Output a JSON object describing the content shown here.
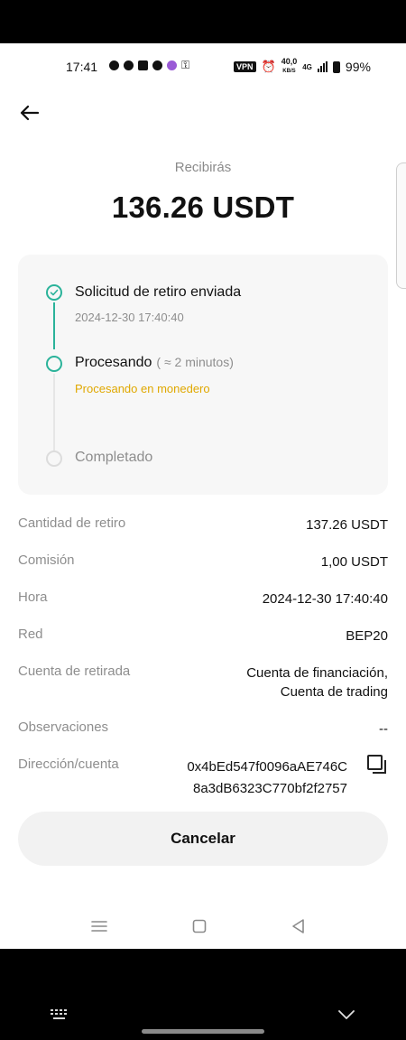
{
  "status_bar": {
    "time": "17:41",
    "vpn": "VPN",
    "speed_value": "40,0",
    "speed_unit": "KB/S",
    "network": "4G",
    "battery": "99%"
  },
  "header": {
    "receive_label": "Recibirás",
    "amount": "136.26 USDT"
  },
  "timeline": {
    "steps": [
      {
        "title": "Solicitud de retiro enviada",
        "subtitle": "2024-12-30 17:40:40",
        "state": "done"
      },
      {
        "title": "Procesando",
        "eta": "( ≈ 2 minutos)",
        "subtitle": "Procesando en monedero",
        "state": "active"
      },
      {
        "title": "Completado",
        "state": "pending"
      }
    ],
    "active_color": "#2bb39a",
    "warning_color": "#e0a800"
  },
  "details": [
    {
      "label": "Cantidad de retiro",
      "value": "137.26 USDT"
    },
    {
      "label": "Comisión",
      "value": "1,00 USDT"
    },
    {
      "label": "Hora",
      "value": "2024-12-30 17:40:40"
    },
    {
      "label": "Red",
      "value": "BEP20"
    },
    {
      "label": "Cuenta de retirada",
      "value_lines": [
        "Cuenta de financiación,",
        "Cuenta de trading"
      ]
    },
    {
      "label": "Observaciones",
      "value": "--"
    },
    {
      "label": "Dirección/cuenta",
      "value_lines": [
        "0x4bEd547f0096aAE746C",
        "8a3dB6323C770bf2f2757"
      ]
    }
  ],
  "actions": {
    "cancel_label": "Cancelar"
  },
  "icons": {
    "back": "arrow-left-icon",
    "copy": "copy-icon",
    "nav_menu": "menu-icon",
    "nav_home": "square-icon",
    "nav_back": "triangle-back-icon",
    "keyboard": "keyboard-icon",
    "collapse": "chevron-down-icon"
  }
}
